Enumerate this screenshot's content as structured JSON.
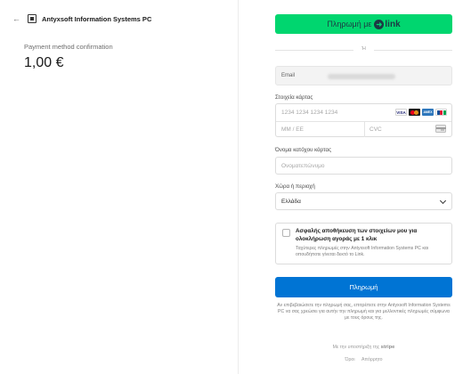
{
  "merchant": {
    "back_icon": "arrow-left-icon",
    "logo_icon": "merchant-logo-icon",
    "name": "Antyxsoft Information Systems PC"
  },
  "summary": {
    "label": "Payment method confirmation",
    "amount": "1,00 €"
  },
  "link_button": {
    "label": "Πληρωμή με",
    "brand_arrow": "➜",
    "brand_word": "link",
    "color": "#00d66f"
  },
  "divider": {
    "text": "Ή"
  },
  "email": {
    "label": "Email"
  },
  "card": {
    "label": "Στοιχεία κάρτας",
    "number_placeholder": "1234 1234 1234 1234",
    "expiry_placeholder": "MM / ΕΕ",
    "cvc_placeholder": "CVC",
    "brands": [
      "VISA",
      "mastercard",
      "AMEX",
      "JCB"
    ]
  },
  "cardholder": {
    "label": "Όνομα κατόχου κάρτας",
    "placeholder": "Ονοματεπώνυμο"
  },
  "country": {
    "label": "Χώρα ή περιοχή",
    "value": "Ελλάδα"
  },
  "save": {
    "title": "Ασφαλής αποθήκευση των στοιχείων μου για ολοκλήρωση αγοράς με 1 κλικ",
    "description": "Ταχύτερες πληρωμές στην Antyxsoft Information Systems PC και οπουδήποτε γίνεται δεκτό το Link."
  },
  "pay_button": {
    "label": "Πληρωμή",
    "color": "#0074d4"
  },
  "consent": "Αν επιβεβαιώσετε την πληρωμή σας, επιτρέπετε στην Antyxsoft Information Systems PC να σας χρεώσει για αυτήν την πληρωμή και για μελλοντικές πληρωμές σύμφωνα με τους όρους της.",
  "footer": {
    "powered_text": "Με την υποστήριξη της",
    "stripe": "stripe",
    "terms": "Όροι",
    "privacy": "Απόρρητο"
  }
}
